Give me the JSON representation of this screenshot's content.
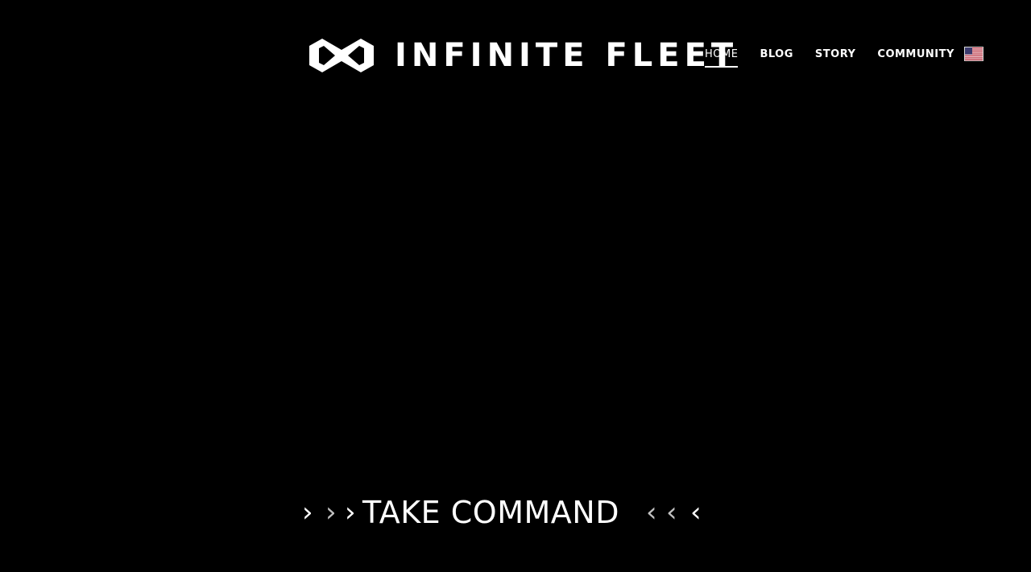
{
  "brand": {
    "name": "INFINITE FLEET",
    "logo_icon": "infinity-hex-logo-icon"
  },
  "nav": {
    "items": [
      {
        "label": "HOME",
        "active": true
      },
      {
        "label": "BLOG",
        "active": false
      },
      {
        "label": "STORY",
        "active": false
      },
      {
        "label": "COMMUNITY",
        "active": false
      }
    ],
    "language_icon": "us-flag-icon"
  },
  "hero": {
    "title": "TAKE COMMAND",
    "left_chevrons": ">>>",
    "right_chevrons": "<<<"
  },
  "colors": {
    "background": "#000000",
    "text": "#ffffff",
    "dim_chevron": "#bfbfbf"
  }
}
